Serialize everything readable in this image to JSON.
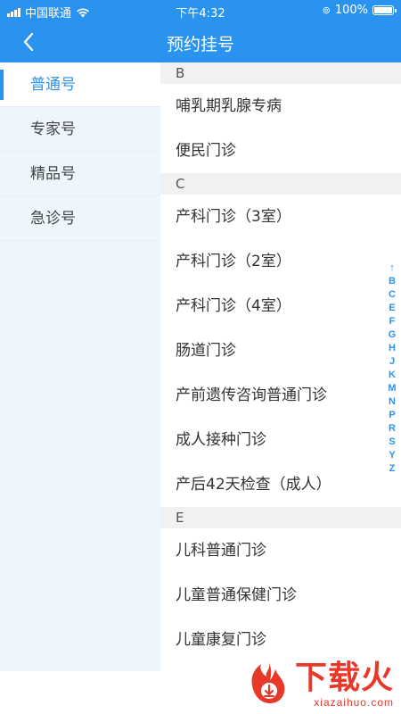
{
  "status_bar": {
    "carrier": "中国联通",
    "time": "下午4:32",
    "battery": "100%"
  },
  "nav": {
    "title": "预约挂号"
  },
  "sidebar": {
    "items": [
      {
        "label": "普通号",
        "active": true
      },
      {
        "label": "专家号",
        "active": false
      },
      {
        "label": "精品号",
        "active": false
      },
      {
        "label": "急诊号",
        "active": false
      }
    ]
  },
  "sections": [
    {
      "letter": "B",
      "items": [
        "哺乳期乳腺专病",
        "便民门诊"
      ]
    },
    {
      "letter": "C",
      "items": [
        "产科门诊（3室）",
        "产科门诊（2室）",
        "产科门诊（4室）",
        "肠道门诊",
        "产前遗传咨询普通门诊",
        "成人接种门诊",
        "产后42天检查（成人）"
      ]
    },
    {
      "letter": "E",
      "items": [
        "儿科普通门诊",
        "儿童普通保健门诊",
        "儿童康复门诊"
      ]
    }
  ],
  "alpha_index": [
    "↑",
    "B",
    "C",
    "E",
    "F",
    "G",
    "H",
    "J",
    "K",
    "M",
    "N",
    "P",
    "R",
    "S",
    "Y",
    "Z"
  ],
  "watermark": {
    "title": "下载火",
    "url": "xiazaihuo.com"
  },
  "colors": {
    "accent": "#2a93f0",
    "sidebar_bg": "#eef6fd",
    "watermark": "#e8382a"
  }
}
